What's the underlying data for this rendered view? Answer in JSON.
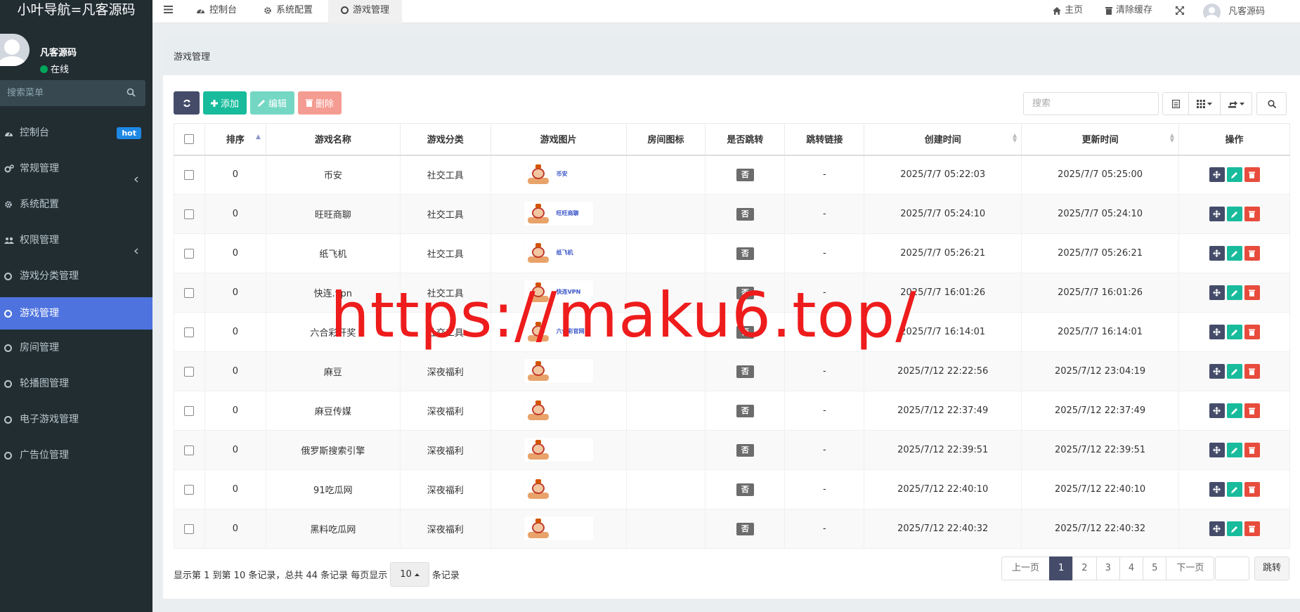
{
  "brand": "小叶导航=凡客源码",
  "user": {
    "name": "凡客源码",
    "status": "在线"
  },
  "sidebar_search": {
    "placeholder": "搜索菜单"
  },
  "menu": [
    {
      "label": "控制台",
      "badge": "hot",
      "icon": "dashboard-icon"
    },
    {
      "label": "常规管理",
      "icon": "cogs-icon",
      "has_children": true
    },
    {
      "label": "系统配置",
      "icon": "gear-icon"
    },
    {
      "label": "权限管理",
      "icon": "users-icon",
      "has_children": true
    },
    {
      "label": "游戏分类管理",
      "icon": "circle-icon"
    },
    {
      "label": "游戏管理",
      "icon": "circle-icon",
      "active": true
    },
    {
      "label": "房间管理",
      "icon": "circle-icon"
    },
    {
      "label": "轮播图管理",
      "icon": "circle-icon"
    },
    {
      "label": "电子游戏管理",
      "icon": "circle-icon"
    },
    {
      "label": "广告位管理",
      "icon": "circle-icon"
    }
  ],
  "tabs": [
    {
      "label": "控制台"
    },
    {
      "label": "系统配置"
    },
    {
      "label": "游戏管理",
      "active": true
    }
  ],
  "top_right": {
    "home": "主页",
    "clear_cache": "清除缓存",
    "user": "凡客源码"
  },
  "page_title": "游戏管理",
  "toolbar": {
    "add": "添加",
    "edit": "编辑",
    "delete": "删除",
    "search_placeholder": "搜索"
  },
  "columns": [
    "排序",
    "游戏名称",
    "游戏分类",
    "游戏图片",
    "房间图标",
    "是否跳转",
    "跳转链接",
    "创建时间",
    "更新时间",
    "操作"
  ],
  "rows": [
    {
      "sort": "0",
      "name": "币安",
      "category": "社交工具",
      "img_label": "币安",
      "jump": "否",
      "link": "-",
      "created": "2025/7/7 05:22:03",
      "updated": "2025/7/7 05:25:00"
    },
    {
      "sort": "0",
      "name": "旺旺商聊",
      "category": "社交工具",
      "img_label": "旺旺商聊",
      "jump": "否",
      "link": "-",
      "created": "2025/7/7 05:24:10",
      "updated": "2025/7/7 05:24:10"
    },
    {
      "sort": "0",
      "name": "纸飞机",
      "category": "社交工具",
      "img_label": "纸飞机",
      "jump": "否",
      "link": "-",
      "created": "2025/7/7 05:26:21",
      "updated": "2025/7/7 05:26:21"
    },
    {
      "sort": "0",
      "name": "快连.vpn",
      "category": "社交工具",
      "img_label": "快连VPN",
      "jump": "否",
      "link": "-",
      "created": "2025/7/7 16:01:26",
      "updated": "2025/7/7 16:01:26"
    },
    {
      "sort": "0",
      "name": "六合彩开奖",
      "category": "社交工具",
      "img_label": "六合彩官网",
      "jump": "否",
      "link": "-",
      "created": "2025/7/7 16:14:01",
      "updated": "2025/7/7 16:14:01"
    },
    {
      "sort": "0",
      "name": "麻豆",
      "category": "深夜福利",
      "img_label": "",
      "jump": "否",
      "link": "-",
      "created": "2025/7/12 22:22:56",
      "updated": "2025/7/12 23:04:19"
    },
    {
      "sort": "0",
      "name": "麻豆传媒",
      "category": "深夜福利",
      "img_label": "",
      "jump": "否",
      "link": "-",
      "created": "2025/7/12 22:37:49",
      "updated": "2025/7/12 22:37:49"
    },
    {
      "sort": "0",
      "name": "俄罗斯搜索引擎",
      "category": "深夜福利",
      "img_label": "",
      "jump": "否",
      "link": "-",
      "created": "2025/7/12 22:39:51",
      "updated": "2025/7/12 22:39:51"
    },
    {
      "sort": "0",
      "name": "91吃瓜网",
      "category": "深夜福利",
      "img_label": "",
      "jump": "否",
      "link": "-",
      "created": "2025/7/12 22:40:10",
      "updated": "2025/7/12 22:40:10"
    },
    {
      "sort": "0",
      "name": "黑料吃瓜网",
      "category": "深夜福利",
      "img_label": "",
      "jump": "否",
      "link": "-",
      "created": "2025/7/12 22:40:32",
      "updated": "2025/7/12 22:40:32"
    }
  ],
  "footer": {
    "info_prefix": "显示第 1 到第 10 条记录，总共 44 条记录 每页显示",
    "page_size": "10",
    "info_suffix": "条记录",
    "prev": "上一页",
    "next": "下一页",
    "pages": [
      "1",
      "2",
      "3",
      "4",
      "5"
    ],
    "current_page": "1",
    "jump": "跳转"
  },
  "watermark": "https://maku6.top/",
  "colors": {
    "sidebar": "#222d32",
    "active": "#4e73df",
    "primary_dark": "#444c69",
    "success": "#18bc9c",
    "danger": "#e74c3c",
    "watermark": "#ee1c1c"
  }
}
